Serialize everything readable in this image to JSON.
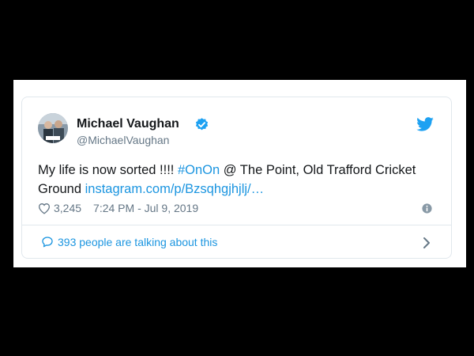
{
  "tweet": {
    "author": {
      "display_name": "Michael Vaughan",
      "handle": "@MichaelVaughan",
      "verified": true
    },
    "text_plain_1": "My life is now sorted !!!! ",
    "hashtag": "#OnOn",
    "text_plain_2": " @ The Point, Old Trafford Cricket Ground ",
    "link": "instagram.com/p/Bzsqhgjhjlj/…",
    "like_count": "3,245",
    "timestamp": "7:24 PM - Jul 9, 2019",
    "conversation": "393 people are talking about this"
  },
  "colors": {
    "background": "#000000",
    "link": "#1b95e0",
    "text": "#14171a",
    "muted": "#657786",
    "border": "#e1e8ed"
  },
  "icons": {
    "verified": "verified-badge-icon",
    "bird": "twitter-bird-icon",
    "like": "heart-icon",
    "info": "info-icon",
    "reply": "speech-bubble-icon",
    "chevron": "chevron-right-icon"
  }
}
